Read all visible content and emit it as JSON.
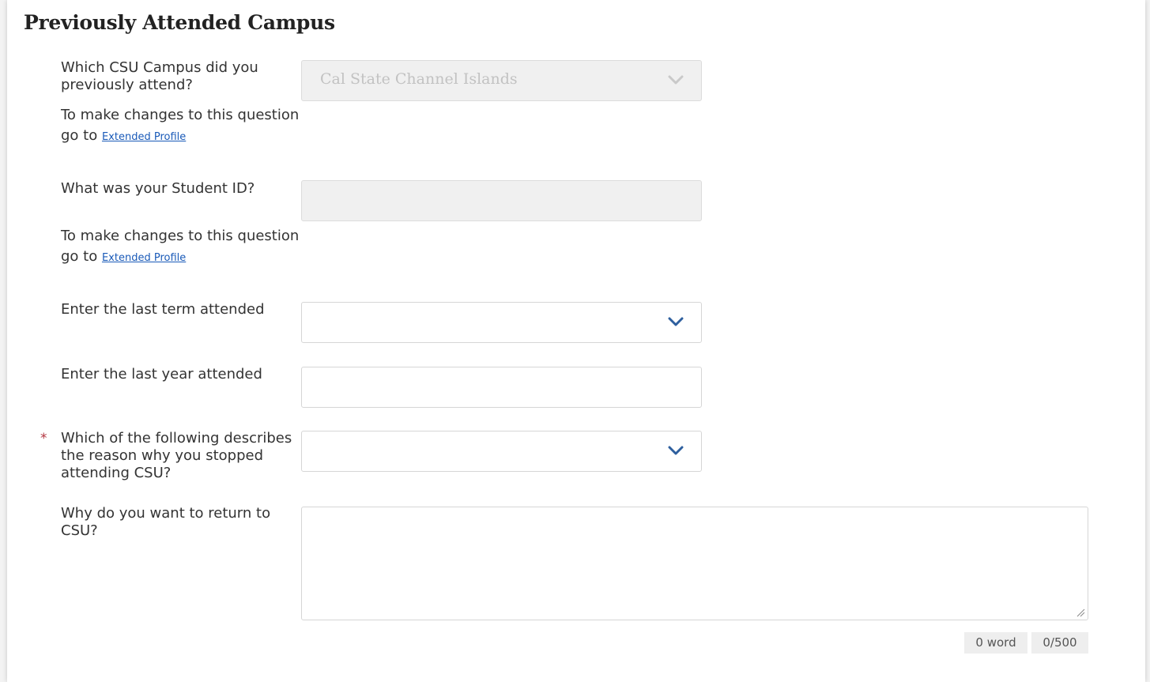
{
  "section": {
    "title": "Previously Attended Campus"
  },
  "campus": {
    "label": "Which CSU Campus did you previously attend?",
    "value": "Cal State Channel Islands",
    "hint_text": "To make changes to this question go to",
    "hint_link": "Extended Profile",
    "icon": "chevron-down-icon"
  },
  "student_id": {
    "label": "What was your Student ID?",
    "value": "",
    "hint_text": "To make changes to this question go to",
    "hint_link": "Extended Profile"
  },
  "last_term": {
    "label": "Enter the last term attended",
    "value": "",
    "icon": "chevron-down-icon"
  },
  "last_year": {
    "label": "Enter the last year attended",
    "value": ""
  },
  "reason": {
    "required_mark": "*",
    "label": "Which of the following describes the reason why you stopped attending CSU?",
    "value": "",
    "icon": "chevron-down-icon"
  },
  "return_reason": {
    "label": "Why do you want to return to CSU?",
    "value": "",
    "word_count": "0 word",
    "char_count": "0/500"
  },
  "colors": {
    "link": "#1a5ab8",
    "chevron_active": "#2e5f9e",
    "chevron_disabled": "#c9c9c9",
    "required": "#b3343f"
  }
}
